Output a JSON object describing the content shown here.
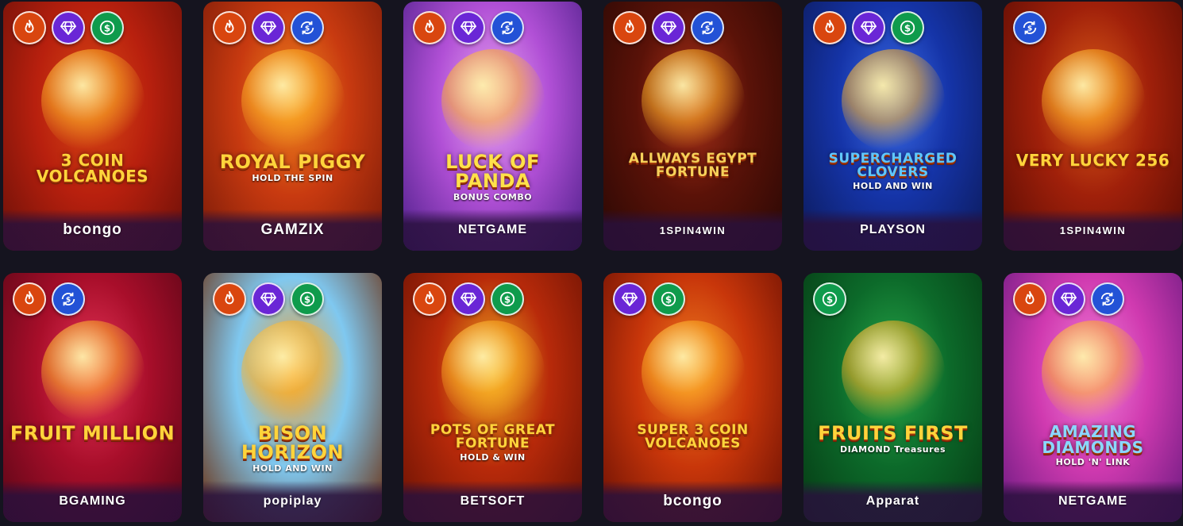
{
  "games": [
    {
      "title": "3 COIN VOLCANOES",
      "subtitle": "",
      "provider": "bcongo",
      "badges": [
        "hot",
        "gem",
        "cash"
      ],
      "bg": [
        "#b8200e",
        "#d84a14",
        "#6b1008"
      ],
      "titleColor": "#ffd43b"
    },
    {
      "title": "ROYAL PIGGY",
      "subtitle": "HOLD THE SPIN",
      "provider": "GAMZIX",
      "badges": [
        "hot",
        "gem",
        "cycle"
      ],
      "bg": [
        "#c83a10",
        "#f08a1e",
        "#7a1a08"
      ],
      "titleColor": "#ffd43b"
    },
    {
      "title": "LUCK OF PANDA",
      "subtitle": "BONUS COMBO",
      "provider": "NETGAME",
      "badges": [
        "hot",
        "gem",
        "cycle"
      ],
      "bg": [
        "#b150d6",
        "#e8a7f0",
        "#4e1f8a"
      ],
      "titleColor": "#ffe14a"
    },
    {
      "title": "ALLWAYS EGYPT FORTUNE",
      "subtitle": "",
      "provider": "1SPIN4WIN",
      "badges": [
        "hot",
        "gem",
        "cycle"
      ],
      "bg": [
        "#5a1208",
        "#b0341a",
        "#2a0804"
      ],
      "titleColor": "#f6d15a"
    },
    {
      "title": "SUPERCHARGED CLOVERS",
      "subtitle": "HOLD AND WIN",
      "provider": "PLAYSON",
      "badges": [
        "hot",
        "gem",
        "cash"
      ],
      "bg": [
        "#1534a8",
        "#3d6ee8",
        "#0c1a5a"
      ],
      "titleColor": "#5fc8ff"
    },
    {
      "title": "VERY LUCKY 256",
      "subtitle": "",
      "provider": "1SPIN4WIN",
      "badges": [
        "cycle"
      ],
      "bg": [
        "#a0200a",
        "#e0621a",
        "#5a0c04"
      ],
      "titleColor": "#ffd43b"
    },
    {
      "title": "FRUIT MILLION",
      "subtitle": "",
      "provider": "BGAMING",
      "badges": [
        "hot",
        "cycle"
      ],
      "bg": [
        "#a80e2a",
        "#e8365a",
        "#5a0616"
      ],
      "titleColor": "#ffd43b"
    },
    {
      "title": "BISON HORIZON",
      "subtitle": "HOLD AND WIN",
      "provider": "popiplay",
      "badges": [
        "hot",
        "gem",
        "cash"
      ],
      "bg": [
        "#7fc8f0",
        "#f0a030",
        "#6a2a08"
      ],
      "titleColor": "#ffd43b"
    },
    {
      "title": "POTS OF GREAT FORTUNE",
      "subtitle": "HOLD & WIN",
      "provider": "BETSOFT",
      "badges": [
        "hot",
        "gem",
        "cash"
      ],
      "bg": [
        "#b82a0a",
        "#f0b020",
        "#6a1204"
      ],
      "titleColor": "#ffd43b"
    },
    {
      "title": "SUPER 3 COIN VOLCANOES",
      "subtitle": "",
      "provider": "bcongo",
      "badges": [
        "gem",
        "cash"
      ],
      "bg": [
        "#c8360a",
        "#f08020",
        "#6a1004"
      ],
      "titleColor": "#ffd43b"
    },
    {
      "title": "FRUITS FIRST",
      "subtitle": "DIAMOND Treasures",
      "provider": "Apparat",
      "badges": [
        "cash"
      ],
      "bg": [
        "#0c6a2a",
        "#28a84a",
        "#063a14"
      ],
      "titleColor": "#ffd43b"
    },
    {
      "title": "AMAZING DIAMONDS",
      "subtitle": "HOLD 'N' LINK",
      "provider": "NETGAME",
      "badges": [
        "hot",
        "gem",
        "cycle"
      ],
      "bg": [
        "#d03ab0",
        "#f080d8",
        "#6a1a80"
      ],
      "titleColor": "#8ad8ff"
    }
  ]
}
